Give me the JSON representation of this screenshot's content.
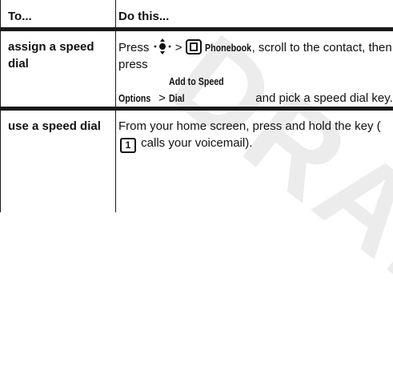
{
  "header": {
    "col1": "To...",
    "col2": "Do this..."
  },
  "rows": [
    {
      "task": "assign a speed dial",
      "text": {
        "press": "Press",
        "gt1": ">",
        "phonebook": "Phonebook",
        "after_phonebook": ", scroll to the contact, then press",
        "options": "Options",
        "gt2": ">",
        "add_speed_dial": "Add to Speed Dial",
        "end": "and pick a speed dial key."
      }
    },
    {
      "task": "use a speed dial",
      "text": {
        "start": "From your home screen, press and hold the key (",
        "key": "1",
        "end": "calls your voicemail)."
      }
    }
  ],
  "watermark": "DRAFT",
  "icons": {
    "nav_key": "center-nav-key-icon",
    "phonebook": "phonebook-icon",
    "key_one": "number-key-1-icon"
  }
}
